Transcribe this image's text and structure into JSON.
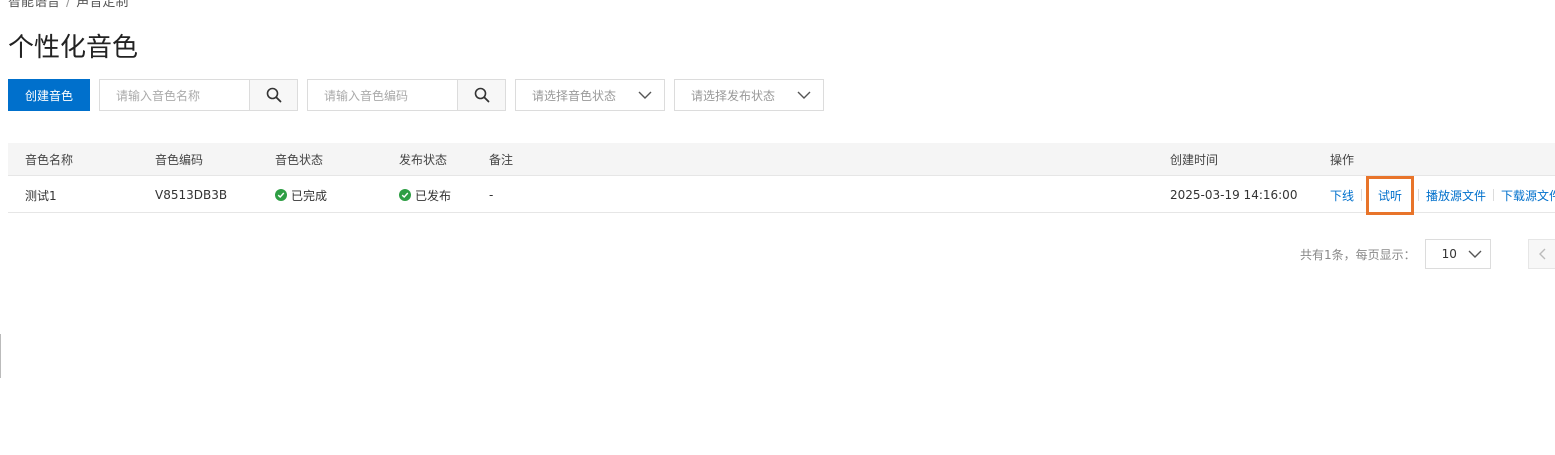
{
  "breadcrumb": [
    "智能语音",
    "声音定制"
  ],
  "page_title": "个性化音色",
  "toolbar": {
    "create_label": "创建音色",
    "name_search_placeholder": "请输入音色名称",
    "code_search_placeholder": "请输入音色编码",
    "voice_status_placeholder": "请选择音色状态",
    "publish_status_placeholder": "请选择发布状态"
  },
  "table": {
    "headers": {
      "name": "音色名称",
      "code": "音色编码",
      "voice_status": "音色状态",
      "publish_status": "发布状态",
      "remark": "备注",
      "created": "创建时间",
      "actions": "操作"
    },
    "rows": [
      {
        "name": "测试1",
        "code": "V8513DB3B",
        "voice_status": "已完成",
        "publish_status": "已发布",
        "remark": "-",
        "created": "2025-03-19 14:16:00",
        "actions": {
          "offline": "下线",
          "listen": "试听",
          "play_source": "播放源文件",
          "download_source": "下载源文件"
        }
      }
    ]
  },
  "pagination": {
    "total_text": "共有1条，每页显示：",
    "page_size": "10"
  },
  "colors": {
    "primary": "#0070cc",
    "success": "#2e9e44",
    "highlight": "#e8742a"
  }
}
